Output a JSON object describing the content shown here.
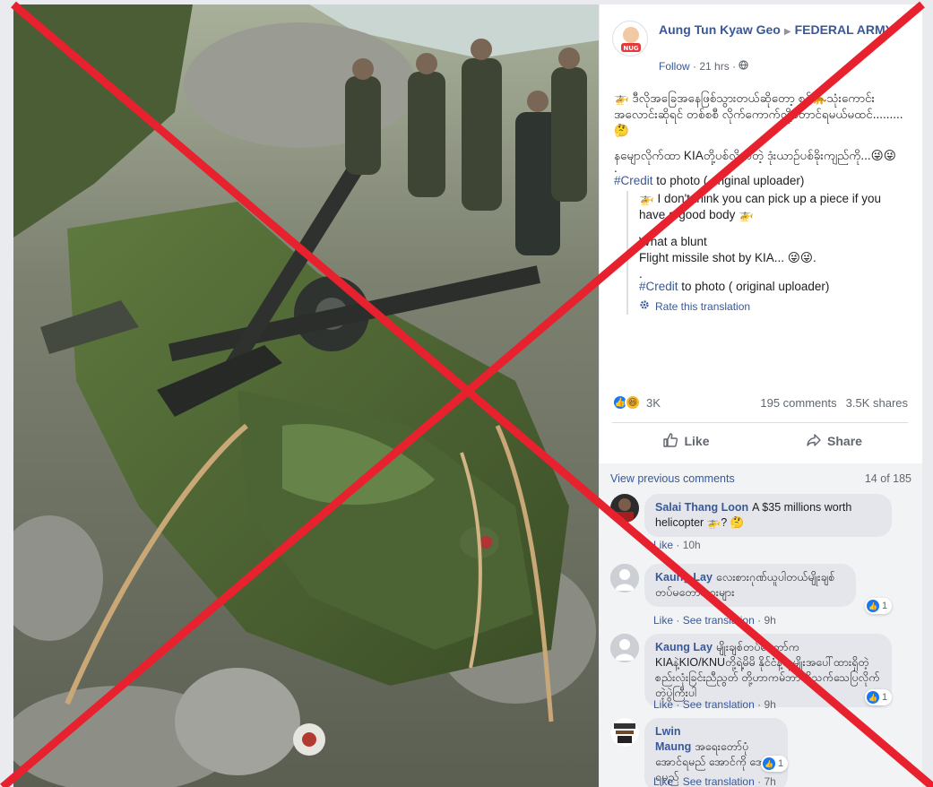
{
  "post": {
    "author": "Aung Tun Kyaw Geo",
    "group": "FEDERAL ARMY",
    "follow": "Follow",
    "time": "21 hrs",
    "paragraph1": "🚁 ဒီလိုအခြေအနေဖြစ်သွားတယ်ဆိုတော့ စစ်🐆သုံးကောင်းအလောင်းဆိုရင် တစ်စစီ လိုက်ကောက်လို့တောင်ရမယ်မထင်.........🤔",
    "paragraph2": "နမျောလိုက်ထာ KIAတို့ပစ်လိုက်တဲ့ ဒုံးယာဉ်ပစ်ခိုးကျည်ကို...😜😜",
    "credit_tag": "#Credit",
    "credit_text": " to photo ( original uploader)",
    "translation_line1": "🚁 I don't think you can pick up a piece if you have a good body 🚁",
    "translation_line2": "What a blunt",
    "translation_line3": "Flight missile shot by KIA... 😜😜.",
    "translation_dot": ".",
    "translation_credit_tag": "#Credit",
    "translation_credit_text": " to photo ( original uploader)",
    "rate_translation": "Rate this translation",
    "dot": "."
  },
  "stats": {
    "reactions": "3K",
    "comments": "195 comments",
    "shares": "3.5K shares"
  },
  "actions": {
    "like": "Like",
    "share": "Share"
  },
  "comments": {
    "view_previous": "View previous comments",
    "pagination": "14 of 185",
    "items": [
      {
        "name": "Salai Thang Loon",
        "text": "A $35 millions worth helicopter 🚁? 🤔",
        "like": "Like",
        "see_translation": "",
        "time": "10h",
        "reactions": ""
      },
      {
        "name": "Kaung Lay",
        "text": "လေးစားဂုဏ်ယူပါတယ်မျိုးချစ် တပ်မတော်သားများ",
        "like": "Like",
        "see_translation": "See translation",
        "time": "9h",
        "reactions": "1"
      },
      {
        "name": "Kaung Lay",
        "text": "မျိုးချစ်တပ်မတော်က KIAနဲ့KIO/KNUတို့ရဲ့မိမိ နိုင်ငံနဲ့လူမျိုးအပေါ်ထားရှိတဲ့စည်းလုံးခြင်းညီညွတ် တို့ဟာကမ်ဘာကိုသက်သေပြလိုက်တဲ့ပွဲကြီးပါ",
        "like": "Like",
        "see_translation": "See translation",
        "time": "9h",
        "reactions": "1"
      },
      {
        "name": "Lwin Maung",
        "text": "အရေးတော်ပုံ အောင်ရမည် အောင်ကို အောင်ရမည်",
        "like": "Like",
        "see_translation": "See translation",
        "time": "7h",
        "reactions": "1"
      }
    ]
  },
  "icons": {
    "globe": "globe-icon",
    "like": "thumbs-up-icon",
    "share": "share-arrow-icon",
    "gear": "gear-icon"
  },
  "colors": {
    "link": "#385898",
    "cross": "#e8212e"
  }
}
